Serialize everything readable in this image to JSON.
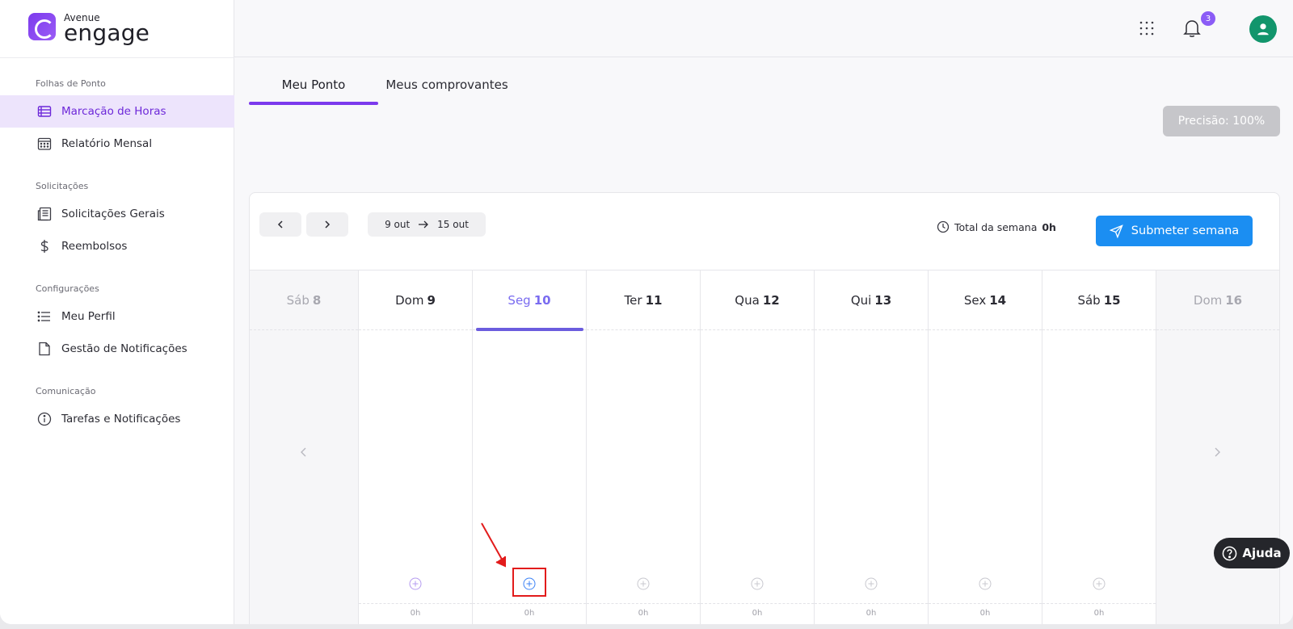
{
  "brand": {
    "small": "Avenue",
    "big": "engage"
  },
  "sidebar": {
    "sections": [
      {
        "title": "Folhas de Ponto",
        "items": [
          {
            "label": "Marcação de Horas",
            "icon": "timesheet-icon",
            "active": true
          },
          {
            "label": "Relatório Mensal",
            "icon": "calendar-icon"
          }
        ]
      },
      {
        "title": "Solicitações",
        "items": [
          {
            "label": "Solicitações Gerais",
            "icon": "document-list-icon"
          },
          {
            "label": "Reembolsos",
            "icon": "dollar-icon"
          }
        ]
      },
      {
        "title": "Configurações",
        "items": [
          {
            "label": "Meu Perfil",
            "icon": "list-icon"
          },
          {
            "label": "Gestão de Notificações",
            "icon": "file-icon"
          }
        ]
      },
      {
        "title": "Comunicação",
        "items": [
          {
            "label": "Tarefas e Notificações",
            "icon": "info-icon"
          }
        ]
      }
    ]
  },
  "topbar": {
    "notification_count": "3"
  },
  "tabs": [
    {
      "label": "Meu Ponto",
      "active": true
    },
    {
      "label": "Meus comprovantes"
    }
  ],
  "precision": "Precisão: 100%",
  "week": {
    "start": "9 out",
    "end": "15 out",
    "total_label": "Total da semana",
    "total_value": "0h",
    "submit_label": "Submeter semana",
    "days": [
      {
        "name": "Sáb",
        "num": "8",
        "state": "faded"
      },
      {
        "name": "Dom",
        "num": "9",
        "total": "0h"
      },
      {
        "name": "Seg",
        "num": "10",
        "state": "today",
        "total": "0h"
      },
      {
        "name": "Ter",
        "num": "11",
        "total": "0h"
      },
      {
        "name": "Qua",
        "num": "12",
        "total": "0h"
      },
      {
        "name": "Qui",
        "num": "13",
        "total": "0h"
      },
      {
        "name": "Sex",
        "num": "14",
        "total": "0h"
      },
      {
        "name": "Sáb",
        "num": "15",
        "total": "0h"
      },
      {
        "name": "Dom",
        "num": "16",
        "state": "faded"
      }
    ]
  },
  "help_label": "Ajuda",
  "colors": {
    "accent": "#7c3aed",
    "primary": "#1b8ef2",
    "today": "#6b5cde",
    "highlight": "#e21b1b"
  }
}
